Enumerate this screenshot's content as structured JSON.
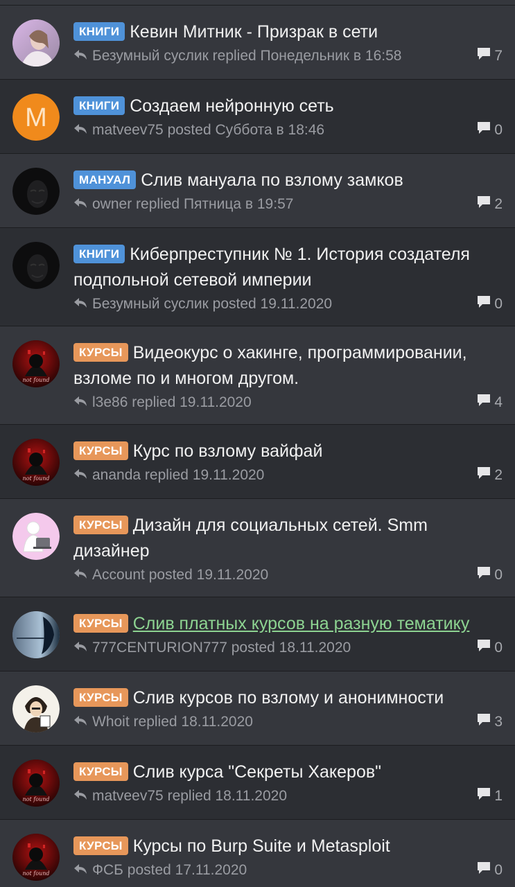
{
  "threads": [
    {
      "tag": "КНИГИ",
      "tag_color": "#4f92d9",
      "title": "Кевин Митник - Призрак в сети",
      "user": "Безумный суслик",
      "action": "replied",
      "when": "Понедельник в 16:58",
      "replies": "7",
      "avatar": "girl-photo"
    },
    {
      "tag": "КНИГИ",
      "tag_color": "#4f92d9",
      "title": "Создаем нейронную сеть",
      "user": "matveev75",
      "action": "posted",
      "when": "Суббота в 18:46",
      "replies": "0",
      "avatar": "letter",
      "avatar_letter": "M"
    },
    {
      "tag": "МАНУАЛ",
      "tag_color": "#4f92d9",
      "title": "Слив мануала по взлому замков",
      "user": "owner",
      "action": "replied",
      "when": "Пятница в 19:57",
      "replies": "2",
      "avatar": "mask"
    },
    {
      "tag": "КНИГИ",
      "tag_color": "#4f92d9",
      "title": "Киберпреступник № 1. История создателя подпольной сетевой империи",
      "user": "Безумный суслик",
      "action": "posted",
      "when": "19.11.2020",
      "replies": "0",
      "avatar": "mask"
    },
    {
      "tag": "КУРСЫ",
      "tag_color": "#e7975a",
      "title": "Видеокурс о хакинге, программировании, взломе по и многом другом.",
      "user": "l3e86",
      "action": "replied",
      "when": "19.11.2020",
      "replies": "4",
      "avatar": "hacker-red",
      "avatar_caption": "not found"
    },
    {
      "tag": "КУРСЫ",
      "tag_color": "#e7975a",
      "title": "Курс по взлому вайфай",
      "user": "ananda",
      "action": "replied",
      "when": "19.11.2020",
      "replies": "2",
      "avatar": "hacker-red",
      "avatar_caption": "not found"
    },
    {
      "tag": "КУРСЫ",
      "tag_color": "#e7975a",
      "title": "Дизайн для социальных сетей. Smm дизайнер",
      "user": "Account",
      "action": "posted",
      "when": "19.11.2020",
      "replies": "0",
      "avatar": "laptop-figure"
    },
    {
      "tag": "КУРСЫ",
      "tag_color": "#e7975a",
      "title": "Слив платных курсов на разную тематику",
      "title_is_link": true,
      "user": "777CENTURION777",
      "action": "posted",
      "when": "18.11.2020",
      "replies": "0",
      "avatar": "centurion"
    },
    {
      "tag": "КУРСЫ",
      "tag_color": "#e7975a",
      "title": "Слив курсов по взлому и анонимности",
      "user": "Whoit",
      "action": "replied",
      "when": "18.11.2020",
      "replies": "3",
      "avatar": "cartoon-hacker"
    },
    {
      "tag": "КУРСЫ",
      "tag_color": "#e7975a",
      "title": "Слив курса \"Секреты Хакеров\"",
      "user": "matveev75",
      "action": "replied",
      "when": "18.11.2020",
      "replies": "1",
      "avatar": "hacker-red",
      "avatar_caption": "not found"
    },
    {
      "tag": "КУРСЫ",
      "tag_color": "#e7975a",
      "title": "Курсы по Burp Suite и Metasploit",
      "user": "ФСБ",
      "action": "posted",
      "when": "17.11.2020",
      "replies": "0",
      "avatar": "hacker-red",
      "avatar_caption": "not found"
    }
  ],
  "colors": {
    "background": "#2c2e33",
    "row_alt": "#35373d",
    "tag_blue": "#4f92d9",
    "tag_orange": "#e7975a",
    "visited_link": "#8dd391",
    "meta_text": "#9a9ca2"
  },
  "icons": {
    "meta": "reply-arrow-icon",
    "count": "speech-bubble-icon"
  }
}
